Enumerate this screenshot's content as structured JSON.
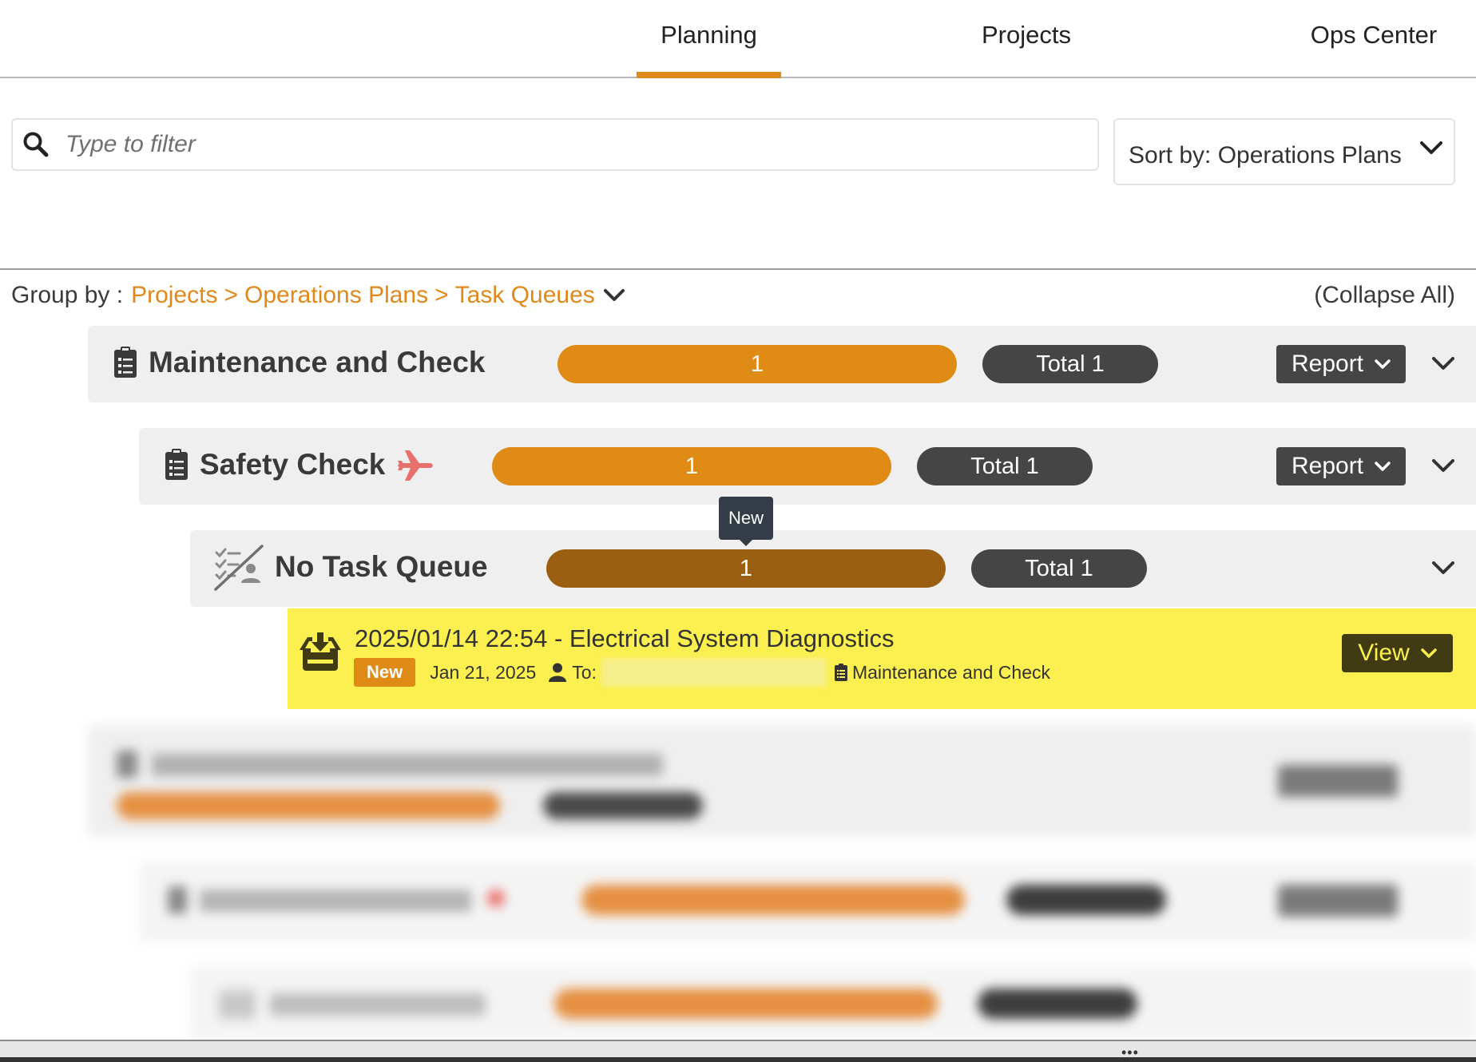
{
  "nav": {
    "tabs": [
      {
        "label": "Planning",
        "active": true
      },
      {
        "label": "Projects",
        "active": false
      },
      {
        "label": "Ops Center",
        "active": false
      }
    ]
  },
  "filter": {
    "placeholder": "Type to filter",
    "value": ""
  },
  "sort": {
    "label": "Sort by: Operations Plans"
  },
  "group_by": {
    "label": "Group by :",
    "levels": [
      "Projects",
      "Operations Plans",
      "Task Queues"
    ],
    "separator": ">",
    "collapse_all": "(Collapse All)"
  },
  "groups": [
    {
      "title": "Maintenance and Check",
      "icon": "clipboard-list-icon",
      "count": "1",
      "total": "Total 1",
      "report_label": "Report"
    },
    {
      "title": "Safety Check",
      "icon": "clipboard-list-icon",
      "badge_icon": "airplane-icon",
      "count": "1",
      "total": "Total 1",
      "report_label": "Report"
    },
    {
      "title": "No Task Queue",
      "icon": "no-task-queue-icon",
      "count": "1",
      "total": "Total 1",
      "tooltip": "New"
    }
  ],
  "task": {
    "title": "2025/01/14 22:54 - Electrical System Diagnostics",
    "status": "New",
    "date": "Jan 21, 2025",
    "to_label": "To:",
    "plan": "Maintenance and Check",
    "view_label": "View"
  },
  "colors": {
    "accent": "#e0881a",
    "bar_orange": "#e08b16",
    "bar_brown": "#9b5f12",
    "pill_dark": "#454545",
    "task_highlight": "#fbf04f",
    "group_bg": "#efefef"
  },
  "footer": {
    "more": "•••"
  }
}
